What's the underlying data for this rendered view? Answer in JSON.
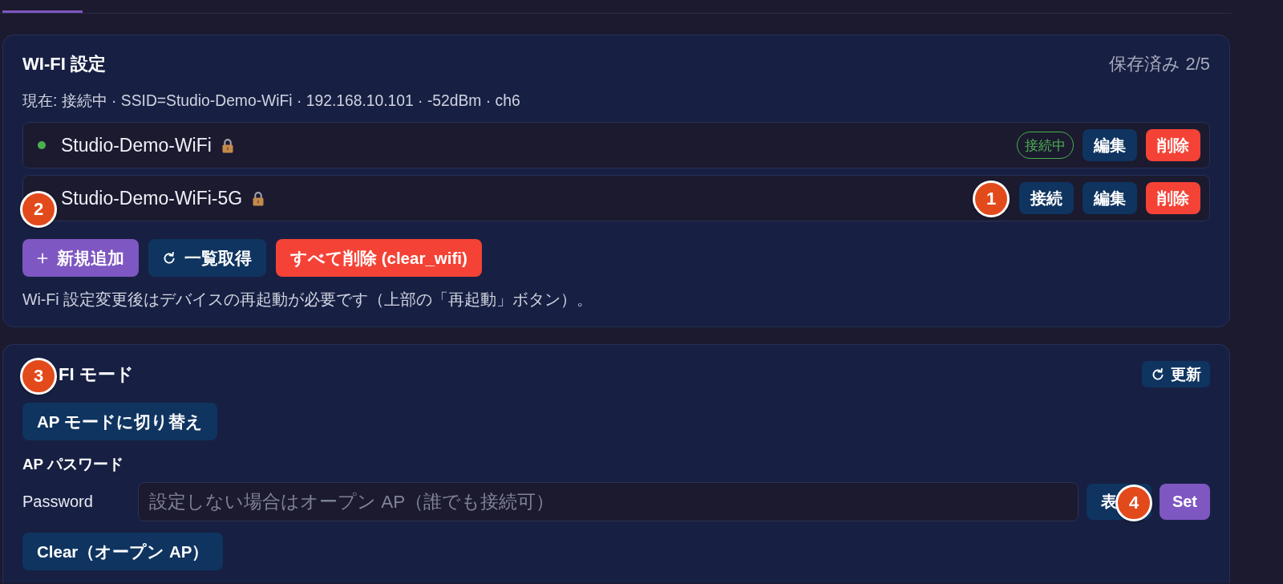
{
  "wifi_settings": {
    "title": "WI-FI 設定",
    "saved_count": "保存済み 2/5",
    "current_status": "現在: 接続中 · SSID=Studio-Demo-WiFi · 192.168.10.101 · -52dBm · ch6",
    "networks": [
      {
        "ssid": "Studio-Demo-WiFi",
        "secured": true,
        "connected": true,
        "status_label": "接続中",
        "actions": [
          {
            "label": "編集",
            "kind": "edit"
          },
          {
            "label": "削除",
            "kind": "delete"
          }
        ]
      },
      {
        "ssid": "Studio-Demo-WiFi-5G",
        "secured": true,
        "connected": false,
        "actions": [
          {
            "label": "接続",
            "kind": "connect"
          },
          {
            "label": "編集",
            "kind": "edit"
          },
          {
            "label": "削除",
            "kind": "delete"
          }
        ]
      }
    ],
    "buttons": [
      {
        "label": "新規追加",
        "kind": "add"
      },
      {
        "label": "一覧取得",
        "kind": "fetch"
      },
      {
        "label": "すべて削除 (clear_wifi)",
        "kind": "danger"
      }
    ],
    "note": "Wi-Fi 設定変更後はデバイスの再起動が必要です（上部の「再起動」ボタン）。"
  },
  "wifi_mode": {
    "title": "FI モード",
    "refresh_button": {
      "label": "更新",
      "kind": "refresh"
    },
    "mode_button": {
      "label": "AP モードに切り替え",
      "kind": "mode"
    },
    "ap_password": {
      "heading": "AP パスワード",
      "label": "Password",
      "placeholder": "設定しない場合はオープン AP（誰でも接続可）",
      "buttons": [
        {
          "label": "表",
          "kind": "reveal"
        },
        {
          "label": "Set",
          "kind": "primary"
        }
      ]
    },
    "clear_button": {
      "label": "Clear（オープン AP）",
      "kind": "clear"
    }
  },
  "callouts": [
    "1",
    "2",
    "3",
    "4"
  ]
}
